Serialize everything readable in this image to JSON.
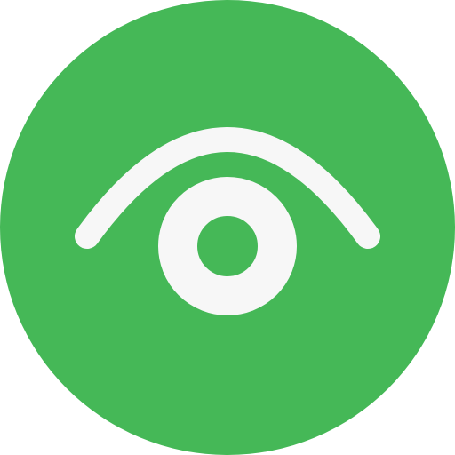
{
  "icon": {
    "name": "eye-icon",
    "background_color": "#45B857",
    "foreground_color": "#F7F7F7"
  }
}
